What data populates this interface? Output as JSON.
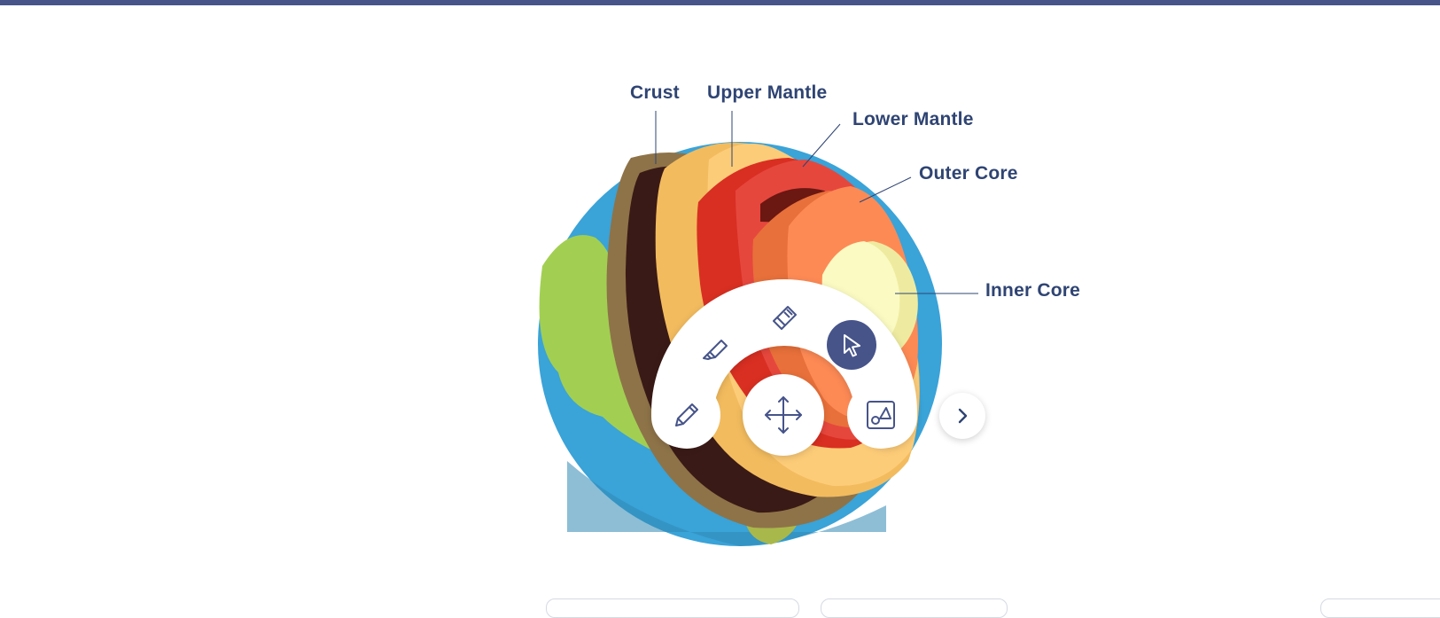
{
  "layers": {
    "crust": "Crust",
    "upper_mantle": "Upper Mantle",
    "lower_mantle": "Lower Mantle",
    "outer_core": "Outer Core",
    "inner_core": "Inner Core"
  },
  "toolbar": {
    "tools": [
      "highlighter-icon",
      "eraser-icon",
      "cursor-icon",
      "pencil-icon",
      "move-icon",
      "shapes-icon"
    ],
    "active_tool": "cursor-icon",
    "next_icon": "chevron-right-icon"
  },
  "colors": {
    "header": "#46548a",
    "label": "#2f4473",
    "ocean": "#3aa3d8",
    "land": "#a2cf52",
    "crust": "#8e7348",
    "upper_mantle": "#f2bb5e",
    "lower_mantle": "#d92f22",
    "outer_core": "#f37a46",
    "inner_core": "#fafac2",
    "active_tool": "#46548a"
  }
}
